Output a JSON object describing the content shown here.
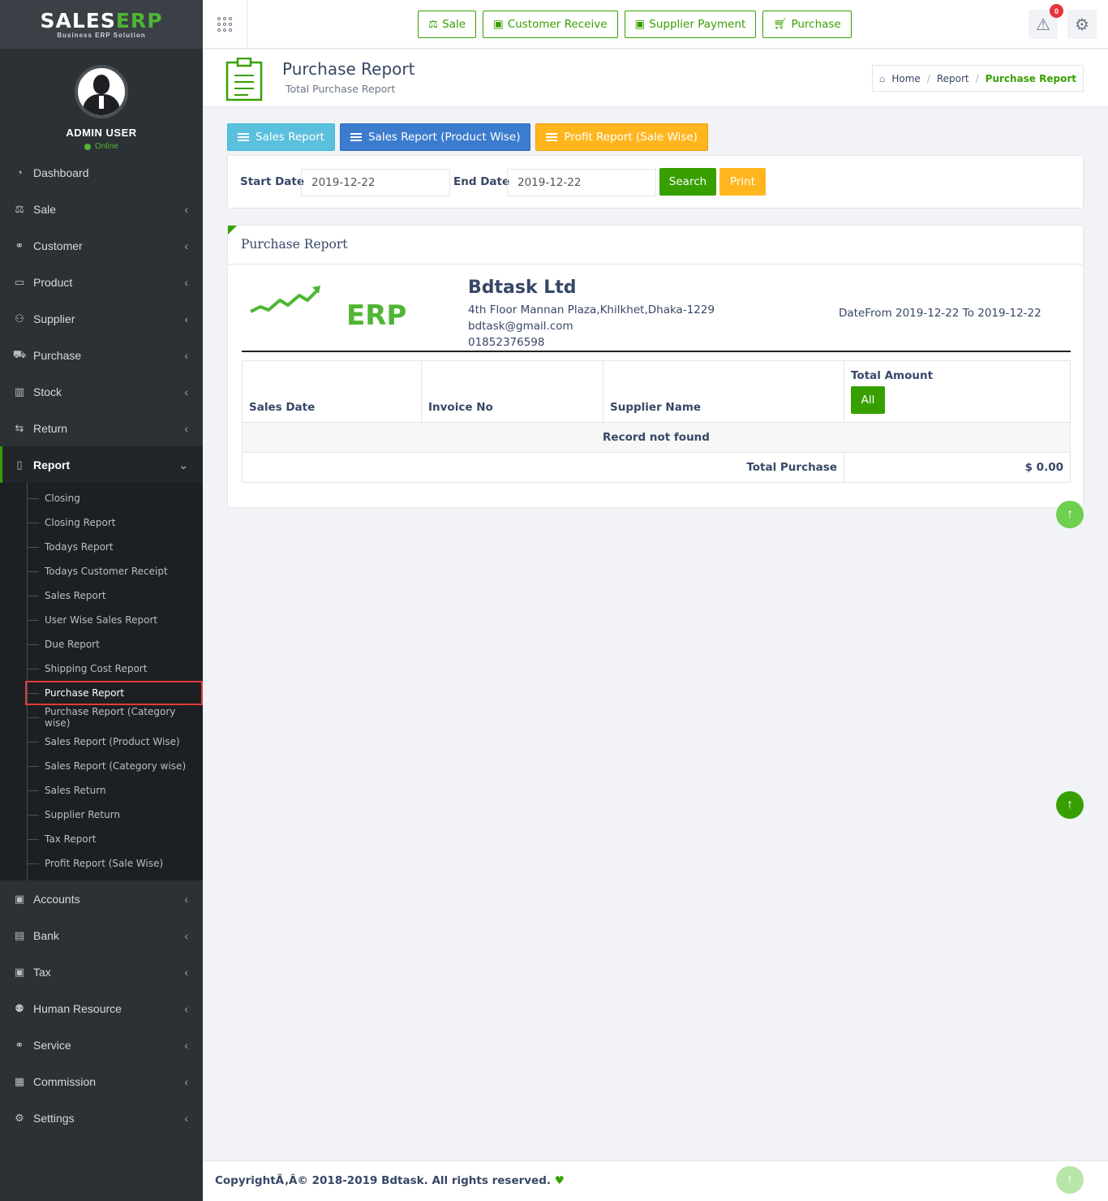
{
  "brand": {
    "logo_main": "SALES",
    "logo_accent": "ERP",
    "logo_sub": "Business ERP Solution"
  },
  "user": {
    "name": "ADMIN USER",
    "status": "Online"
  },
  "sidebar": {
    "items_top": [
      {
        "label": "Dashboard",
        "icon": "dashboard-icon"
      },
      {
        "label": "Sale",
        "icon": "balance-scale-icon"
      },
      {
        "label": "Customer",
        "icon": "handshake-icon"
      },
      {
        "label": "Product",
        "icon": "shopping-bag-icon"
      },
      {
        "label": "Supplier",
        "icon": "user-icon"
      },
      {
        "label": "Purchase",
        "icon": "cart-icon"
      },
      {
        "label": "Stock",
        "icon": "bar-chart-icon"
      },
      {
        "label": "Return",
        "icon": "retweet-icon"
      },
      {
        "label": "Report",
        "icon": "book-icon"
      }
    ],
    "report_submenu": [
      "Closing",
      "Closing Report",
      "Todays Report",
      "Todays Customer Receipt",
      "Sales Report",
      "User Wise Sales Report",
      "Due Report",
      "Shipping Cost Report",
      "Purchase Report",
      "Purchase Report (Category wise)",
      "Sales Report (Product Wise)",
      "Sales Report (Category wise)",
      "Sales Return",
      "Supplier Return",
      "Tax Report",
      "Profit Report (Sale Wise)"
    ],
    "items_bottom": [
      {
        "label": "Accounts",
        "icon": "money-icon"
      },
      {
        "label": "Bank",
        "icon": "briefcase-icon"
      },
      {
        "label": "Tax",
        "icon": "money-icon"
      },
      {
        "label": "Human Resource",
        "icon": "users-icon"
      },
      {
        "label": "Service",
        "icon": "handshake-icon"
      },
      {
        "label": "Commission",
        "icon": "grid-icon"
      },
      {
        "label": "Settings",
        "icon": "gear-icon"
      }
    ]
  },
  "topbar": {
    "quick_buttons": [
      "Sale",
      "Customer Receive",
      "Supplier Payment",
      "Purchase"
    ],
    "notification_count": "0"
  },
  "page_header": {
    "title": "Purchase Report",
    "subtitle": "Total Purchase Report",
    "breadcrumb": [
      "Home",
      "Report",
      "Purchase Report"
    ]
  },
  "report_buttons": [
    "Sales Report",
    "Sales Report (Product Wise)",
    "Profit Report (Sale Wise)"
  ],
  "filter": {
    "start_label": "Start Date",
    "start_value": "2019-12-22",
    "end_label": "End Date",
    "end_value": "2019-12-22",
    "search_label": "Search",
    "print_label": "Print"
  },
  "report": {
    "panel_title": "Purchase Report",
    "logo_text": "ERP",
    "company_name": "Bdtask Ltd",
    "address": "4th Floor Mannan Plaza,Khilkhet,Dhaka-1229",
    "email": "bdtask@gmail.com",
    "phone": "01852376598",
    "date_range": "DateFrom 2019-12-22 To 2019-12-22",
    "columns": [
      "Sales Date",
      "Invoice No",
      "Supplier Name",
      "Total Amount"
    ],
    "all_button": "All",
    "empty_message": "Record not found",
    "total_label": "Total Purchase",
    "total_value": "$ 0.00"
  },
  "footer": {
    "text": "CopyrightÃ‚Â© 2018-2019 Bdtask. All rights reserved."
  },
  "colors": {
    "accent": "#37a000",
    "sidebar_bg": "#2c3136",
    "info": "#5bc0de",
    "primary": "#3c7ccf",
    "warning": "#ffb61e",
    "danger": "#e5343d"
  }
}
